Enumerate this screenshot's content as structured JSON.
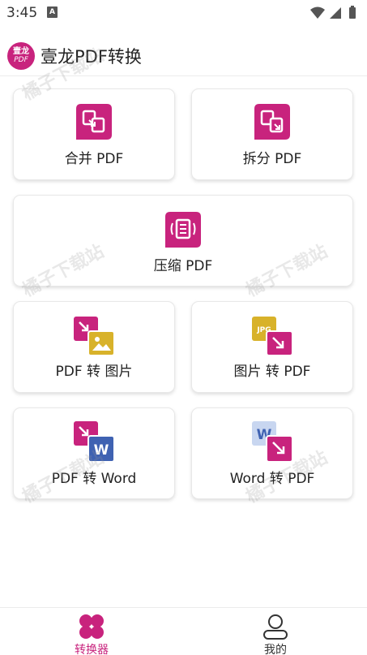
{
  "status_bar": {
    "time": "3:45",
    "notification_letter": "A"
  },
  "header": {
    "logo_line1": "壹龙",
    "logo_line2": "PDF",
    "title": "壹龙PDF转换"
  },
  "cards": [
    {
      "label": "合并 PDF",
      "icon": "merge-pdf-icon"
    },
    {
      "label": "拆分 PDF",
      "icon": "split-pdf-icon"
    },
    {
      "label": "压缩 PDF",
      "icon": "compress-pdf-icon"
    },
    {
      "label": "PDF 转 图片",
      "icon": "pdf-to-image-icon"
    },
    {
      "label": "图片 转 PDF",
      "icon": "image-to-pdf-icon"
    },
    {
      "label": "PDF 转 Word",
      "icon": "pdf-to-word-icon"
    },
    {
      "label": "Word 转 PDF",
      "icon": "word-to-pdf-icon"
    }
  ],
  "icon_text": {
    "jpg": "JPG",
    "w": "W"
  },
  "watermark_text": "橘子下载站",
  "bottom_nav": [
    {
      "label": "转换器",
      "active": true
    },
    {
      "label": "我的",
      "active": false
    }
  ],
  "colors": {
    "accent": "#c8237d",
    "jpg_yellow": "#d8b22a",
    "word_blue": "#3f62b2",
    "word_light": "#c8d6f0"
  }
}
